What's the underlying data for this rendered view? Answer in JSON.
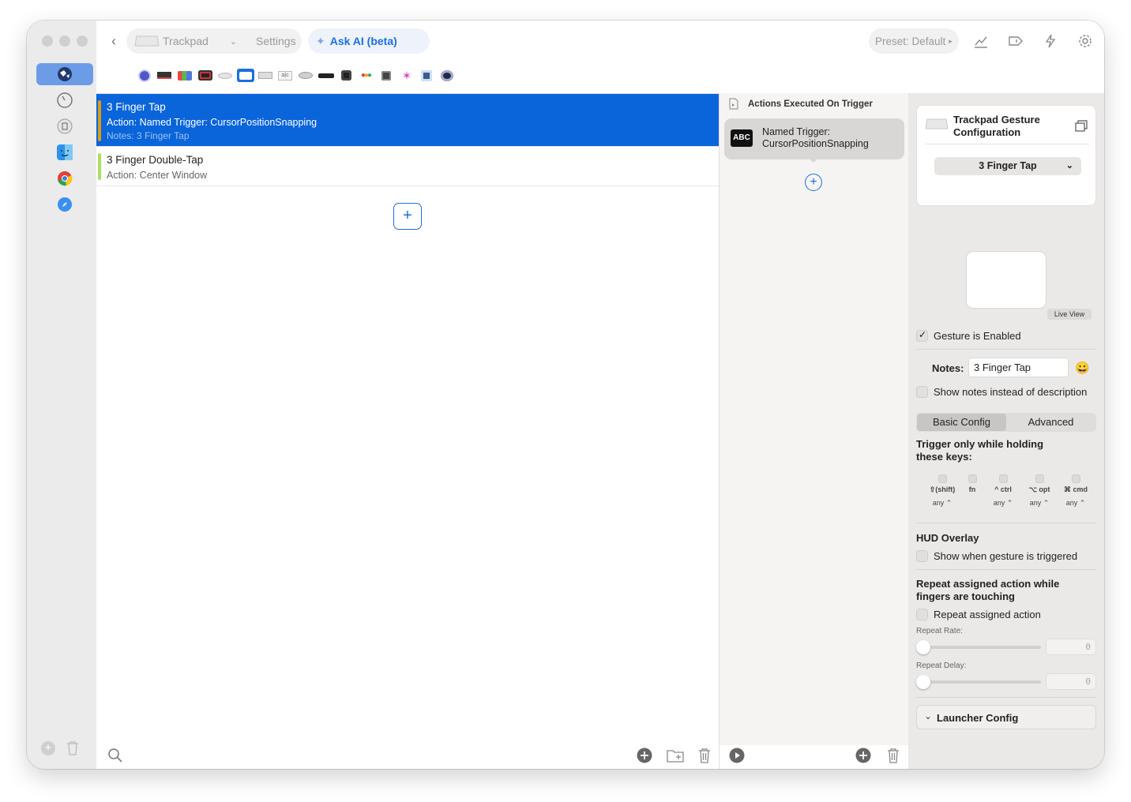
{
  "topbar": {
    "device_label": "Trackpad",
    "settings_label": "Settings",
    "ask_ai_label": "Ask AI (beta)",
    "preset_label": "Preset: Default"
  },
  "triggers": [
    {
      "title": "3 Finger Tap",
      "action": "Action: Named Trigger: CursorPositionSnapping",
      "notes": "Notes: 3 Finger Tap",
      "selected": true,
      "bar_color": "#d4a017"
    },
    {
      "title": "3 Finger Double-Tap",
      "action": "Action: Center Window",
      "notes": "",
      "selected": false,
      "bar_color": "#a8e05f"
    }
  ],
  "actions_panel": {
    "header": "Actions Executed On Trigger",
    "action_icon_text": "ABC",
    "action_line1": "Named Trigger:",
    "action_line2": "CursorPositionSnapping"
  },
  "config": {
    "title_line1": "Trackpad Gesture",
    "title_line2": "Configuration",
    "gesture_select": "3 Finger Tap",
    "live_view_label": "Live View",
    "gesture_enabled_label": "Gesture is Enabled",
    "notes_label": "Notes:",
    "notes_value": "3 Finger Tap",
    "show_notes_label": "Show notes instead of description",
    "tab_basic": "Basic Config",
    "tab_advanced": "Advanced",
    "trigger_keys_line1": "Trigger only while holding",
    "trigger_keys_line2": "these keys:",
    "modifiers": [
      {
        "label": "⇧(shift)",
        "sub": "any ⌃"
      },
      {
        "label": "fn",
        "sub": ""
      },
      {
        "label": "^ ctrl",
        "sub": "any ⌃"
      },
      {
        "label": "⌥ opt",
        "sub": "any ⌃"
      },
      {
        "label": "⌘ cmd",
        "sub": "any ⌃"
      }
    ],
    "hud_title": "HUD Overlay",
    "hud_label": "Show when gesture is triggered",
    "repeat_title_line1": "Repeat assigned action while",
    "repeat_title_line2": "fingers are touching",
    "repeat_label": "Repeat assigned action",
    "repeat_rate_label": "Repeat Rate:",
    "repeat_rate_value": "0",
    "repeat_delay_label": "Repeat Delay:",
    "repeat_delay_value": "0",
    "launcher_label": "Launcher Config"
  },
  "colors": {
    "accent": "#1a6fe0",
    "selected_row": "#0a64da"
  }
}
